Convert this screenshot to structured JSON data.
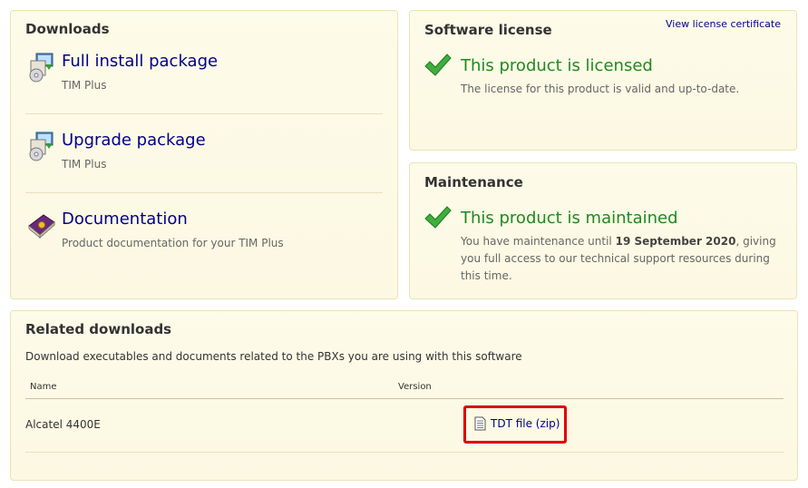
{
  "downloads": {
    "title": "Downloads",
    "items": [
      {
        "label": "Full install package",
        "sub": "TIM Plus",
        "icon": "installer-icon"
      },
      {
        "label": "Upgrade package",
        "sub": "TIM Plus",
        "icon": "installer-icon"
      },
      {
        "label": "Documentation",
        "sub": "Product documentation for your TIM Plus",
        "icon": "book-icon"
      }
    ]
  },
  "license": {
    "title": "Software license",
    "cert_link": "View license certificate",
    "status": "This product is licensed",
    "text": "The license for this product is valid and up-to-date."
  },
  "maintenance": {
    "title": "Maintenance",
    "status": "This product is maintained",
    "text_before": "You have maintenance until ",
    "date": "19 September 2020",
    "text_after": ", giving you full access to our technical support resources during this time."
  },
  "related": {
    "title": "Related downloads",
    "description": "Download executables and documents related to the PBXs you are using with this software",
    "columns": [
      "Name",
      "Version"
    ],
    "rows": [
      {
        "name": "Alcatel 4400E",
        "file_label": "TDT file (zip)"
      }
    ]
  },
  "colors": {
    "panel_bg": "#fcf8e2",
    "panel_border": "#ece3b3",
    "link": "#00008b",
    "status_green": "#1e8a1e",
    "highlight_red": "#e00000"
  }
}
